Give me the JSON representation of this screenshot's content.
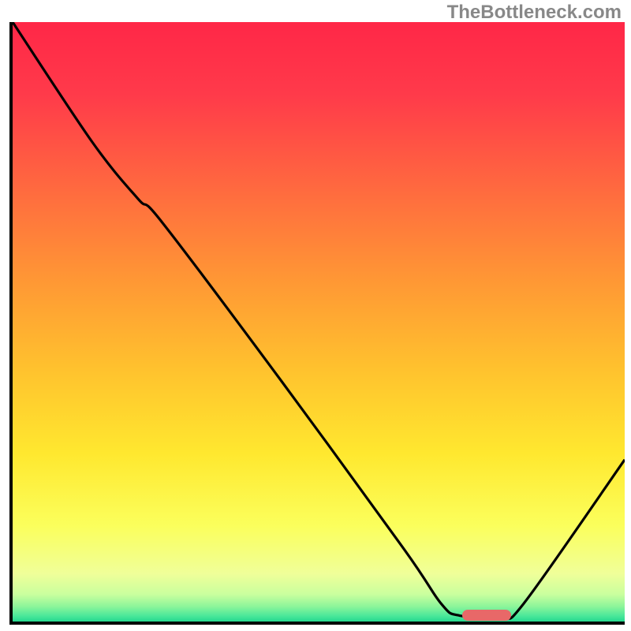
{
  "watermark": "TheBottleneck.com",
  "chart_data": {
    "type": "line",
    "title": "",
    "xlabel": "",
    "ylabel": "",
    "xlim": [
      0,
      100
    ],
    "ylim": [
      0,
      100
    ],
    "gradient_stops": [
      {
        "offset": 0.0,
        "color": "#ff2747"
      },
      {
        "offset": 0.12,
        "color": "#ff3a4a"
      },
      {
        "offset": 0.28,
        "color": "#ff6a3f"
      },
      {
        "offset": 0.44,
        "color": "#ff9a34"
      },
      {
        "offset": 0.58,
        "color": "#ffc22e"
      },
      {
        "offset": 0.72,
        "color": "#ffe82f"
      },
      {
        "offset": 0.84,
        "color": "#fbff5c"
      },
      {
        "offset": 0.92,
        "color": "#f0ff99"
      },
      {
        "offset": 0.955,
        "color": "#c9ff9e"
      },
      {
        "offset": 0.975,
        "color": "#8cf59a"
      },
      {
        "offset": 0.99,
        "color": "#4de89a"
      },
      {
        "offset": 1.0,
        "color": "#25d890"
      }
    ],
    "curve_points": [
      {
        "x": 0.0,
        "y": 100.0
      },
      {
        "x": 13.0,
        "y": 80.0
      },
      {
        "x": 20.5,
        "y": 70.5
      },
      {
        "x": 24.5,
        "y": 66.5
      },
      {
        "x": 44.0,
        "y": 40.0
      },
      {
        "x": 64.0,
        "y": 12.0
      },
      {
        "x": 70.0,
        "y": 3.0
      },
      {
        "x": 73.0,
        "y": 1.0
      },
      {
        "x": 80.0,
        "y": 1.0
      },
      {
        "x": 83.5,
        "y": 3.0
      },
      {
        "x": 100.0,
        "y": 27.0
      }
    ],
    "optimum_range": {
      "x_start": 73.5,
      "x_end": 81.5,
      "y": 1.0
    }
  }
}
